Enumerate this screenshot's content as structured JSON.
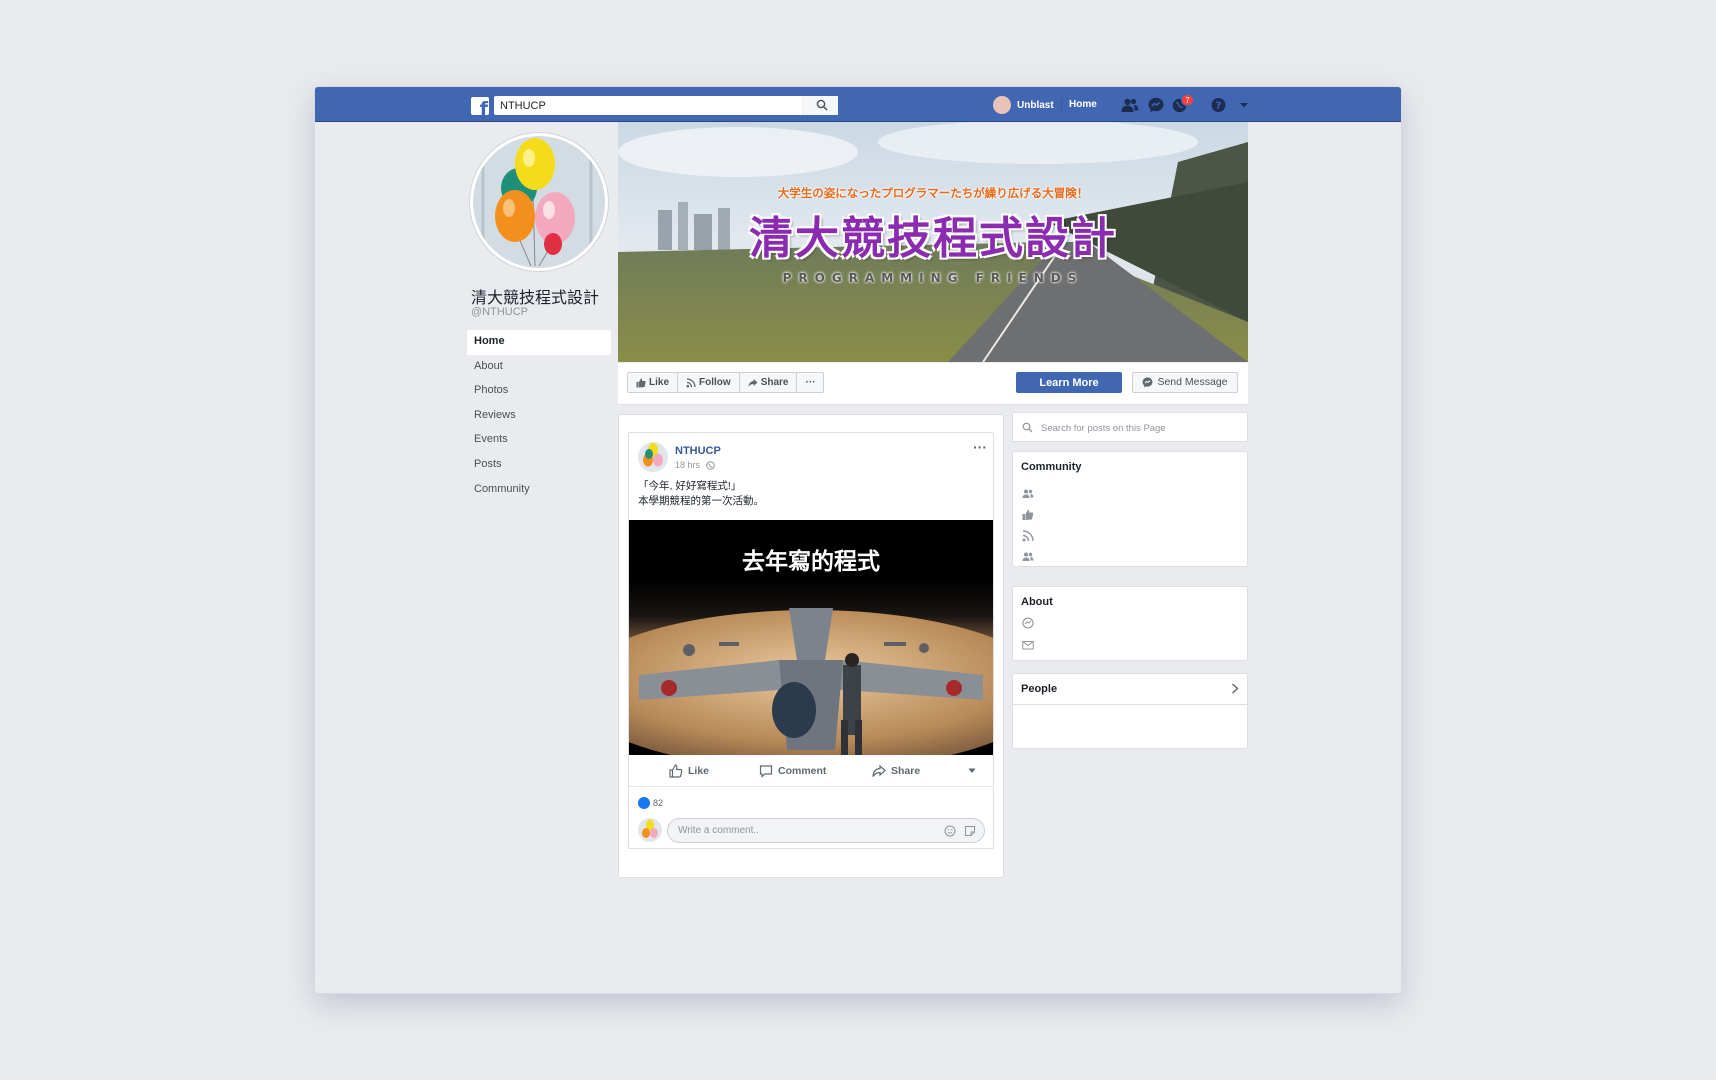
{
  "topbar": {
    "search_value": "NTHUCP",
    "user_name": "Unblast",
    "home_label": "Home",
    "notification_count": "7"
  },
  "page": {
    "name": "清大競技程式設計",
    "handle": "@NTHUCP"
  },
  "left_nav": {
    "items": [
      {
        "label": "Home",
        "active": true
      },
      {
        "label": "About"
      },
      {
        "label": "Photos"
      },
      {
        "label": "Reviews"
      },
      {
        "label": "Events"
      },
      {
        "label": "Posts"
      },
      {
        "label": "Community"
      }
    ]
  },
  "cover": {
    "subtitle_jp": "大学生の姿になったプログラマーたちが繰り広げる大冒険！",
    "title": "清大競技程式設計",
    "tagline": "PROGRAMMING FRIENDS"
  },
  "cover_actions": {
    "like": "Like",
    "follow": "Follow",
    "share": "Share",
    "more": "···",
    "learn_more": "Learn More",
    "send_message": "Send Message"
  },
  "post": {
    "author": "NTHUCP",
    "time": "18 hrs",
    "text_line1": "「今年, 好好寫程式!」",
    "text_line2": "本學期競程的第一次活動。",
    "image_caption": "去年寫的程式",
    "actions": {
      "like": "Like",
      "comment": "Comment",
      "share": "Share"
    },
    "reaction_count": "82",
    "comment_placeholder": "Write a comment.."
  },
  "sidebar": {
    "search_placeholder": "Search for posts on this Page",
    "community_title": "Community",
    "about_title": "About",
    "people_title": "People"
  },
  "colors": {
    "brand": "#4267b2",
    "link": "#385898",
    "badge": "#fa3e3e"
  }
}
